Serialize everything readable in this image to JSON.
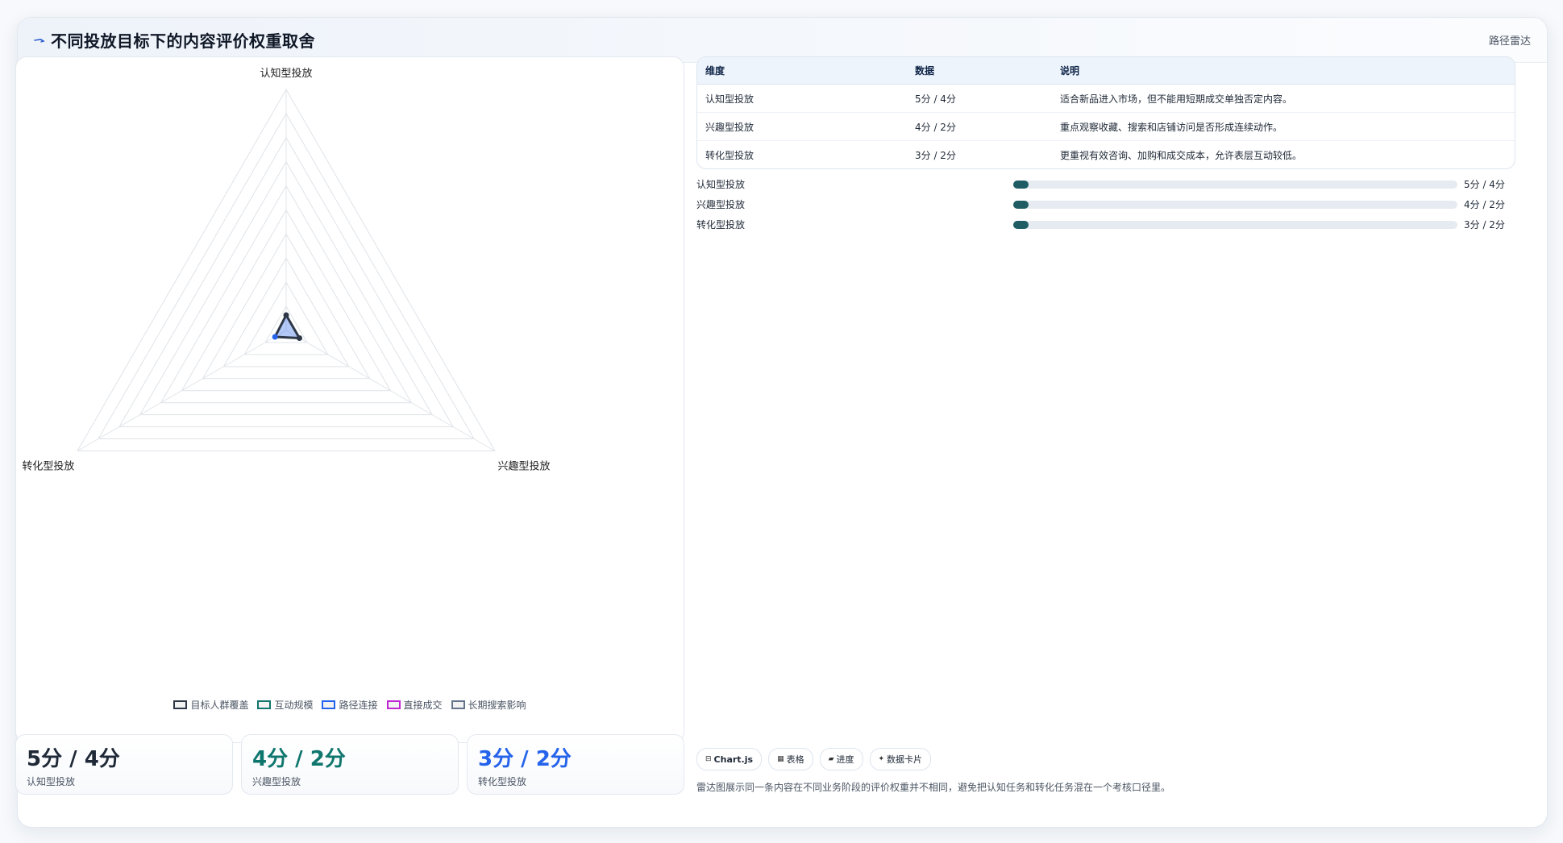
{
  "window": {
    "title": "不同投放目标下的内容评价权重取舍",
    "action_label": "路径雷达",
    "title_icon": "arrow-icon",
    "accent": "#2f5fd0"
  },
  "chart_data": {
    "type": "radar",
    "axes": [
      "认知型投放",
      "兴趣型投放",
      "转化型投放"
    ],
    "scale_levels": 10,
    "series_names": [
      "目标人群覆盖",
      "互动规模",
      "路径连接",
      "直接成交",
      "长期搜索影响"
    ],
    "series_colors": [
      "#2d3748",
      "#0f766e",
      "#2563eb",
      "#c026d3",
      "#64748b"
    ],
    "legend_position": "bottom",
    "grid": true
  },
  "table": {
    "headers": [
      "维度",
      "数据",
      "说明"
    ],
    "rows": [
      [
        "认知型投放",
        "5分 / 4分",
        "适合新品进入市场，但不能用短期成交单独否定内容。"
      ],
      [
        "兴趣型投放",
        "4分 / 2分",
        "重点观察收藏、搜索和店铺访问是否形成连续动作。"
      ],
      [
        "转化型投放",
        "3分 / 2分",
        "更重视有效咨询、加购和成交成本，允许表层互动较低。"
      ]
    ]
  },
  "progress": [
    {
      "label": "认知型投放",
      "value": "5分 / 4分",
      "fraction": 0.03
    },
    {
      "label": "兴趣型投放",
      "value": "4分 / 2分",
      "fraction": 0.03
    },
    {
      "label": "转化型投放",
      "value": "3分 / 2分",
      "fraction": 0.03
    }
  ],
  "stats": [
    {
      "value": "5分 / 4分",
      "label": "认知型投放",
      "color": "#1f2937"
    },
    {
      "value": "4分 / 2分",
      "label": "兴趣型投放",
      "color": "#0f766e"
    },
    {
      "value": "3分 / 2分",
      "label": "转化型投放",
      "color": "#2563eb"
    }
  ],
  "chips": [
    {
      "icon": "chart-icon",
      "glyph": "⊟",
      "label": "Chart.js"
    },
    {
      "icon": "table-icon",
      "glyph": "▦",
      "label": "表格"
    },
    {
      "icon": "progress-icon",
      "glyph": "▰",
      "label": "进度"
    },
    {
      "icon": "card-icon",
      "glyph": "✦",
      "label": "数据卡片"
    }
  ],
  "footnote": "雷达图展示同一条内容在不同业务阶段的评价权重并不相同，避免把认知任务和转化任务混在一个考核口径里。"
}
